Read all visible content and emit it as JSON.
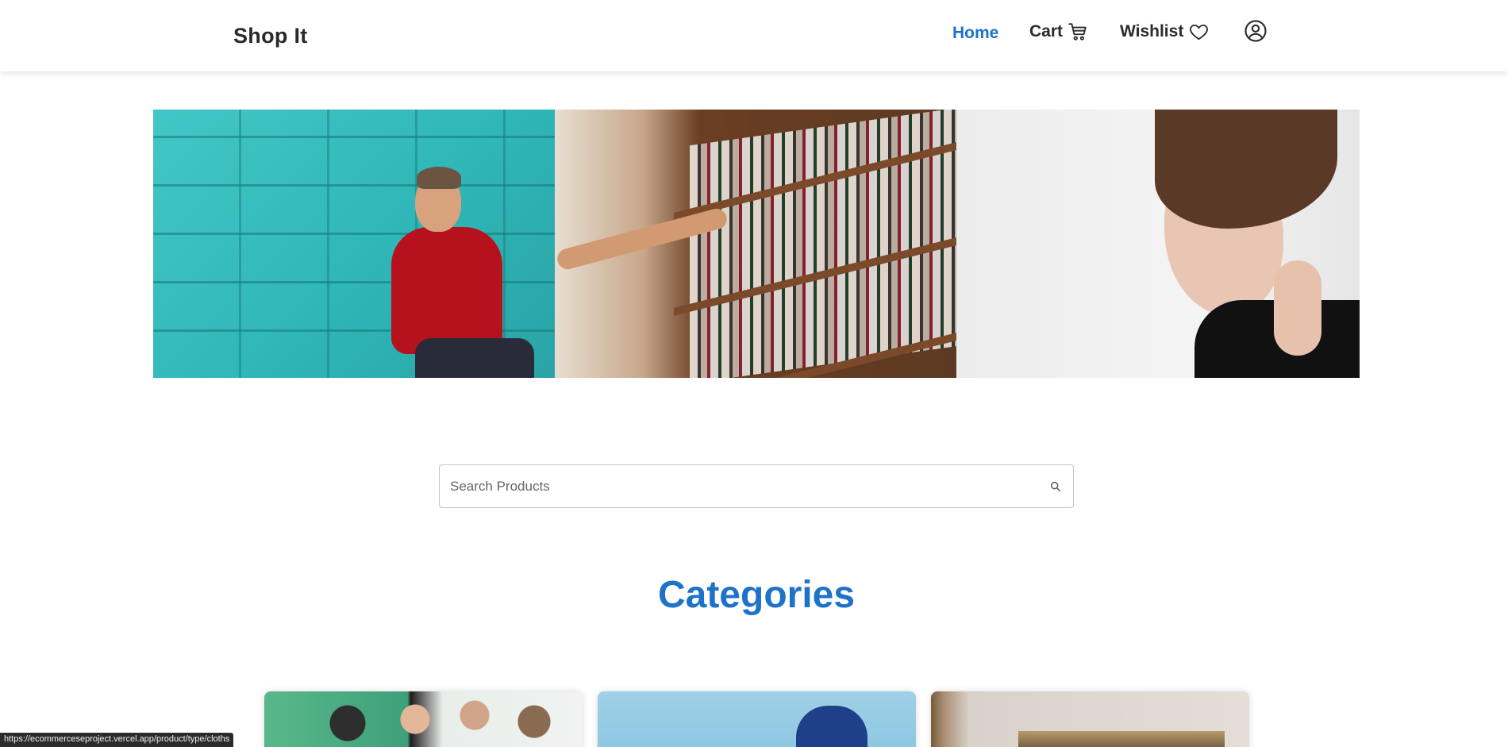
{
  "header": {
    "brand": "Shop It",
    "nav": {
      "home": "Home",
      "cart": "Cart",
      "wishlist": "Wishlist"
    },
    "active_item": "Home",
    "accent_color": "#1e73c8"
  },
  "hero": {
    "panels": [
      {
        "subject": "man in red sweater against teal brick wall"
      },
      {
        "subject": "hand reaching for books on library shelf"
      },
      {
        "subject": "woman with earring portrait"
      }
    ]
  },
  "search": {
    "placeholder": "Search Products",
    "value": "",
    "icon": "search-icon"
  },
  "categories": {
    "title": "Categories",
    "cards": [
      {
        "image": "group of friends clothing"
      },
      {
        "image": "sneaker on blue background"
      },
      {
        "image": "home interior"
      }
    ]
  },
  "status_bar": {
    "url": "https://ecommerceseproject.vercel.app/product/type/cloths"
  }
}
